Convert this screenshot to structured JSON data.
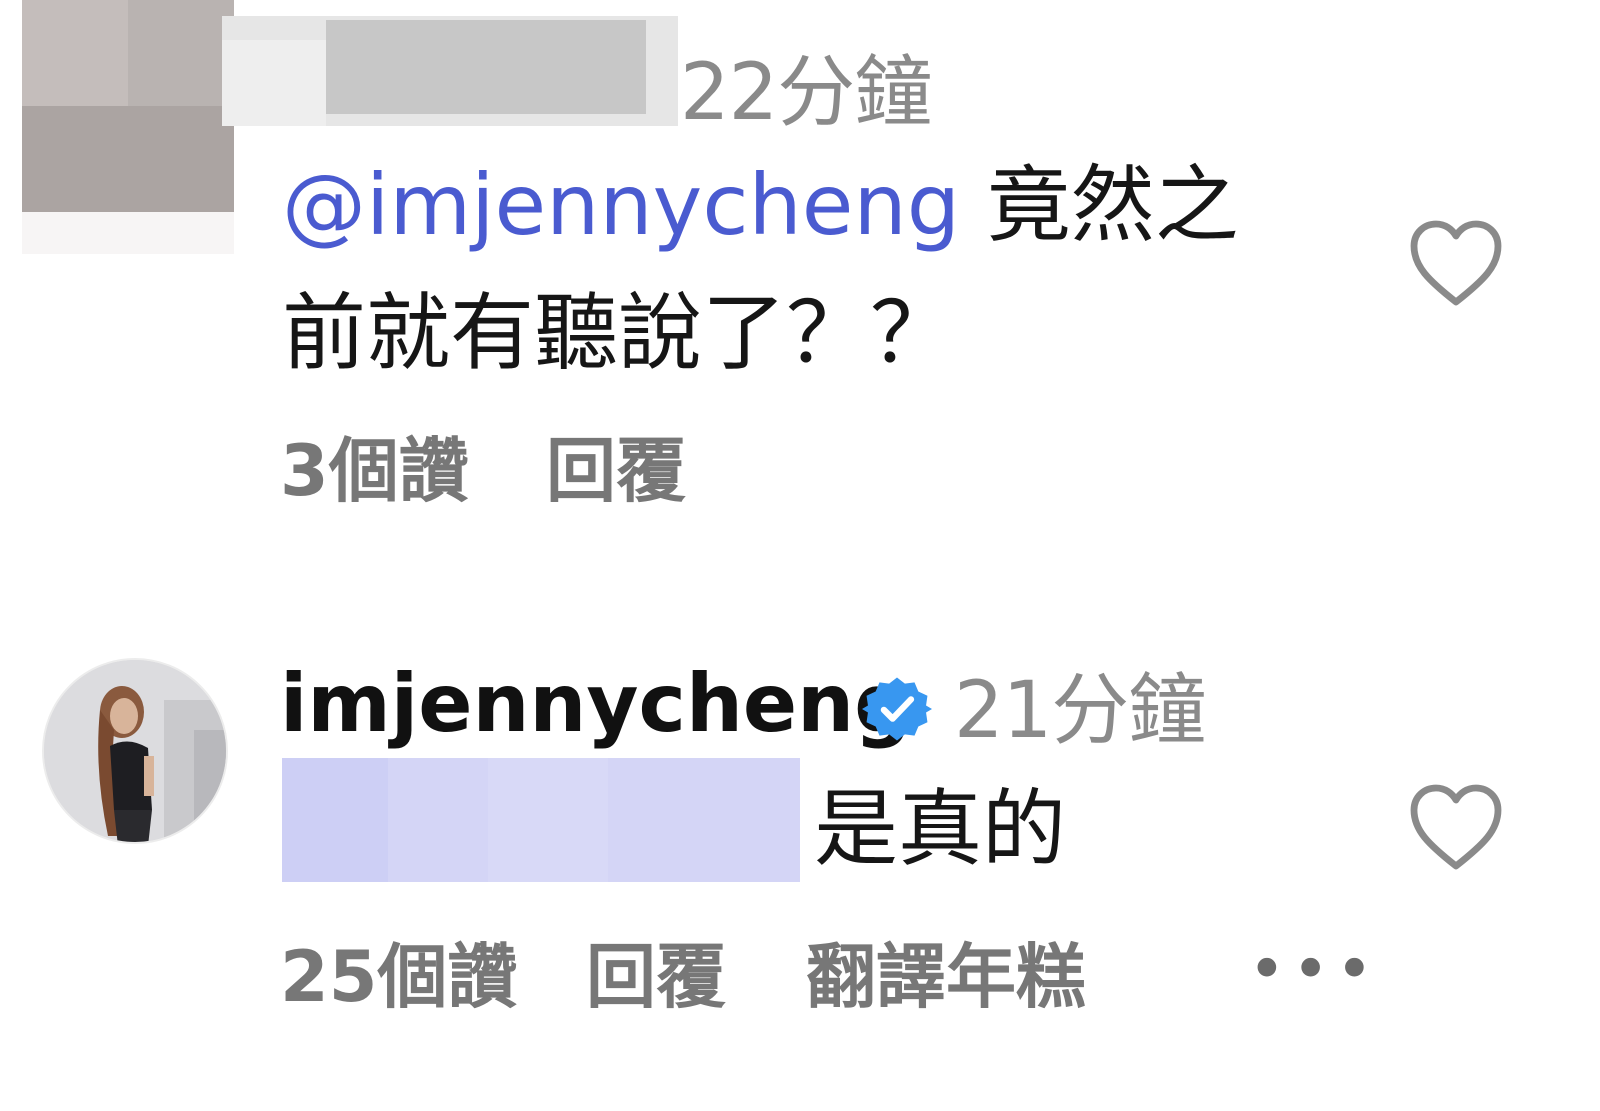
{
  "comments": [
    {
      "username": "",
      "time": "22分鐘",
      "mention": "@imjennycheng",
      "text_line_1_rest": " 竟然之",
      "text_line_2": "前就有聽說了？？",
      "likes": "3個讚",
      "reply_label": "回覆",
      "like_icon": "heart-outline-icon"
    },
    {
      "username": "imjennycheng",
      "verified_icon": "verified-badge-icon",
      "time": "21分鐘",
      "mention": "",
      "text": "是真的",
      "likes": "25個讚",
      "reply_label": "回覆",
      "translate_label": "翻譯年糕",
      "more_label": "•••",
      "like_icon": "heart-outline-icon"
    }
  ],
  "colors": {
    "mention": "#4a5bd0",
    "verified": "#3897f0",
    "meta": "#777777"
  }
}
